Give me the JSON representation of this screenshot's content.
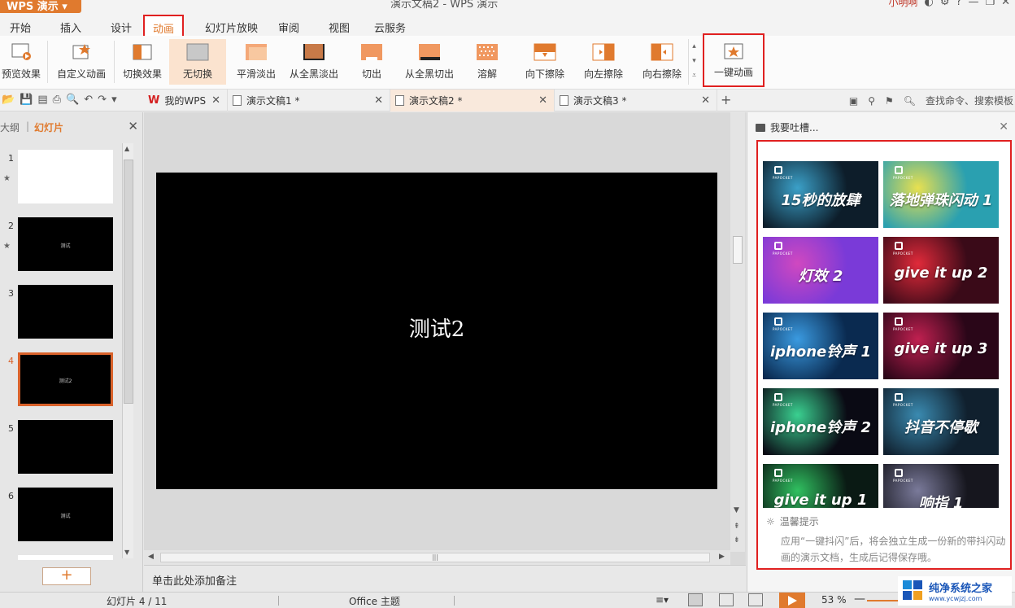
{
  "titlebar": {
    "app_label": "WPS 演示",
    "document_title": "演示文稿2 - WPS 演示",
    "user_name": "小明啊"
  },
  "menu": {
    "tabs": [
      "开始",
      "插入",
      "设计",
      "动画",
      "幻灯片放映",
      "审阅",
      "视图",
      "云服务"
    ],
    "active_tab": "动画"
  },
  "ribbon": {
    "preview": "预览效果",
    "custom_anim": "自定义动画",
    "switch_effect": "切换效果",
    "transitions": [
      "无切换",
      "平滑淡出",
      "从全黑淡出",
      "切出",
      "从全黑切出",
      "溶解",
      "向下擦除",
      "向左擦除",
      "向右擦除"
    ],
    "selected_transition": "无切换",
    "one_click": "一键动画"
  },
  "doc_tabs": {
    "my_wps": "我的WPS",
    "tabs": [
      "演示文稿1 *",
      "演示文稿2 *",
      "演示文稿3 *"
    ],
    "active": "演示文稿2 *",
    "search": "查找命令、搜索模板"
  },
  "left_panel": {
    "tab_outline": "大纲",
    "tab_slides": "幻灯片",
    "thumbs": [
      {
        "num": "1",
        "text": "",
        "white": true,
        "star": true
      },
      {
        "num": "2",
        "text": "测试",
        "white": false,
        "star": true
      },
      {
        "num": "3",
        "text": "",
        "white": false,
        "star": false
      },
      {
        "num": "4",
        "text": "测试2",
        "white": false,
        "star": false
      },
      {
        "num": "5",
        "text": "",
        "white": false,
        "star": false
      },
      {
        "num": "6",
        "text": "测试",
        "white": false,
        "star": false
      }
    ],
    "active_slide": 4,
    "add_button": "+"
  },
  "slide": {
    "text": "测试2"
  },
  "notes_placeholder": "单击此处添加备注",
  "right_panel": {
    "feedback": "我要吐槽...",
    "tile_brand": "PAPOCKET",
    "tiles": [
      {
        "label": "15秒的放肆",
        "bg": "#0d1d2a",
        "accent": "#3ba0c8"
      },
      {
        "label": "落地弹珠闪动 1",
        "bg": "#2aa0b0",
        "accent": "#e8e050"
      },
      {
        "label": "灯效 2",
        "bg": "#7a3ad8",
        "accent": "#d048c0"
      },
      {
        "label": "give it up 2",
        "bg": "#3a0a18",
        "accent": "#e02a3a"
      },
      {
        "label": "iphone铃声 1",
        "bg": "#0a2a50",
        "accent": "#3a9ae0"
      },
      {
        "label": "give it up 3",
        "bg": "#2a0618",
        "accent": "#c02050"
      },
      {
        "label": "iphone铃声 2",
        "bg": "#0a0a14",
        "accent": "#3ad090"
      },
      {
        "label": "抖音不停歇",
        "bg": "#10202e",
        "accent": "#3a8ab0"
      },
      {
        "label": "give it up 1",
        "bg": "#0a1a14",
        "accent": "#30c060"
      },
      {
        "label": "响指 1",
        "bg": "#16161e",
        "accent": "#7a7a9a"
      }
    ],
    "tip_title": "温馨提示",
    "tip_text": "应用“一键抖闪”后，将会独立生成一份新的带抖闪动画的演示文档，生成后记得保存哦。"
  },
  "statusbar": {
    "slide_info": "幻灯片 4 / 11",
    "theme": "Office 主题",
    "zoom": "53 %"
  },
  "watermark": {
    "main": "纯净系统之家",
    "sub": "www.ycwjzj.com"
  }
}
